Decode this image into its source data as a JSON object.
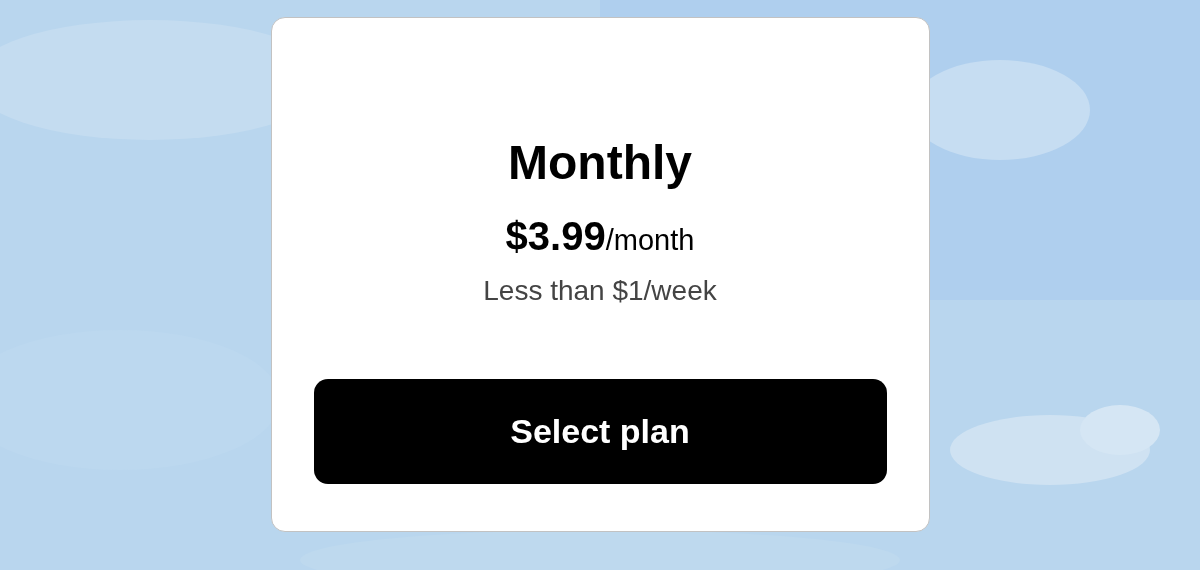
{
  "plan": {
    "title": "Monthly",
    "price": {
      "amount": "$3.99",
      "period": "/month"
    },
    "note": "Less than $1/week",
    "button": "Select plan"
  }
}
